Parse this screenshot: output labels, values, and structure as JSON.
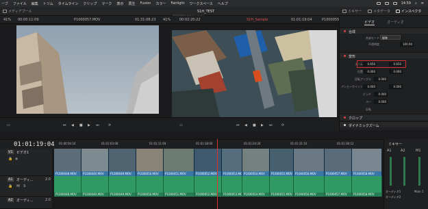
{
  "menubar": {
    "items": [
      "ーブ",
      "ファイル",
      "編集",
      "トリム",
      "タイムライン",
      "クリップ",
      "マーク",
      "表示",
      "再生",
      "Fusion",
      "カラー",
      "Fairlight",
      "ワークスペース",
      "ヘルプ"
    ],
    "time": "14:59"
  },
  "toolbar": {
    "media_pool": "メディアプール",
    "project_title": "S1H_TEST",
    "project_status": "変更が保存されていません",
    "mixer": "ミキサー",
    "metadata": "メタデータ",
    "inspector": "インスペクタ"
  },
  "source_viewer": {
    "zoom": "41%",
    "timecode_left": "00:00:11:09",
    "clip_name": "P1000057.MOV",
    "timecode_right": "01:31:08:23"
  },
  "timeline_viewer": {
    "zoom": "41%",
    "timecode_left": "00:02:20:22",
    "timeline_name": "S1H_Sample",
    "timecode_right": "01:01:19:04",
    "clip_name": "P1000055.MOV"
  },
  "inspector": {
    "tabs": [
      "ビデオ",
      "オーディオ"
    ],
    "sections": {
      "composite": "合成",
      "transform": "変形",
      "crop": "クロップ",
      "dynamic_zoom": "ダイナミックズーム"
    },
    "composite_mode_label": "合成モード",
    "composite_mode_value": "標準",
    "opacity_label": "不透明度",
    "opacity_value": "100.00",
    "zoom_label": "ズーム",
    "zoom_x": "0.650",
    "zoom_y": "0.650",
    "position_label": "位置",
    "position_x": "0.000",
    "position_y": "0.000",
    "rotation_label": "回転アングル",
    "rotation_value": "0.000",
    "anchor_label": "アンカーポイント",
    "anchor_x": "0.000",
    "anchor_y": "0.000",
    "pitch_label": "ピッチ",
    "pitch_value": "0.000",
    "yaw_label": "ヨー",
    "yaw_value": "0.000",
    "flip_label": "反転"
  },
  "timeline": {
    "timecode": "01:01:19:04",
    "ruler": [
      "01:00:56:16",
      "01:01:03:08",
      "01:01:11:04",
      "01:01:18:00",
      "01:01:24:20",
      "01:01:31:16",
      "01:01:38:12"
    ],
    "video_track": {
      "badge": "V1",
      "name": "ビデオ1"
    },
    "audio_track1": {
      "badge": "A1",
      "name": "オーディ...",
      "level": "2.0"
    },
    "audio_track2": {
      "badge": "A2",
      "name": "オーディ...",
      "level": "2.0"
    },
    "video_clips": [
      "P1000048.MOV",
      "P1000040.MOV",
      "P1000049.MOV",
      "P1000050.MOV",
      "P1000051.MOV",
      "P1000052.MOV",
      "P1000053.MOV",
      "P1000054.MOV",
      "P1000055.MOV",
      "P1000056.MOV",
      "P1000057.MOV",
      "P1000058.MOV"
    ],
    "audio_clips": [
      "P1000048.MOV",
      "P1000040.MOV",
      "P1000049.MOV",
      "P1000050.MOV",
      "P1000051.MOV",
      "P1000052.MOV",
      "P1000053.MOV",
      "P1000054.MOV",
      "P1000055.MOV",
      "P1000056.MOV",
      "P1000057.MOV",
      "P1000058.MOV"
    ]
  },
  "mixer": {
    "title": "ミキサー",
    "channels": [
      "A1",
      "A2",
      "M1"
    ],
    "track_label1": "オーディオ1",
    "track_label2": "オーディオ2",
    "main_label": "Main 1"
  }
}
